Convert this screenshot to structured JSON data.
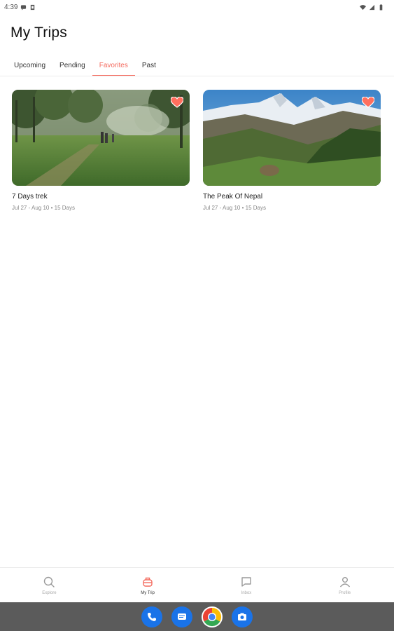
{
  "status_bar": {
    "time": "4:39",
    "icons": [
      "message-icon",
      "clipboard-icon",
      "wifi-icon",
      "signal-icon",
      "battery-icon"
    ]
  },
  "header": {
    "title": "My Trips"
  },
  "tabs": [
    {
      "label": "Upcoming",
      "active": false
    },
    {
      "label": "Pending",
      "active": false
    },
    {
      "label": "Favorites",
      "active": true
    },
    {
      "label": "Past",
      "active": false
    }
  ],
  "trips": [
    {
      "title": "7 Days trek",
      "meta": "Jul 27 - Aug 10 • 15 Days",
      "favorite": true,
      "image": "forest-trail-photo"
    },
    {
      "title": "The Peak Of Nepal",
      "meta": "Jul 27 - Aug 10 • 15 Days",
      "favorite": true,
      "image": "snowy-mountain-photo"
    }
  ],
  "bottom_nav": [
    {
      "label": "Explore",
      "icon": "search-icon",
      "active": false
    },
    {
      "label": "My Trip",
      "icon": "luggage-icon",
      "active": true
    },
    {
      "label": "Inbox",
      "icon": "chat-icon",
      "active": false
    },
    {
      "label": "Profile",
      "icon": "person-icon",
      "active": false
    }
  ],
  "dock": [
    "phone-icon",
    "messages-icon",
    "chrome-icon",
    "camera-icon"
  ],
  "colors": {
    "accent": "#f46b5f",
    "dock": "#5b5b5b"
  }
}
